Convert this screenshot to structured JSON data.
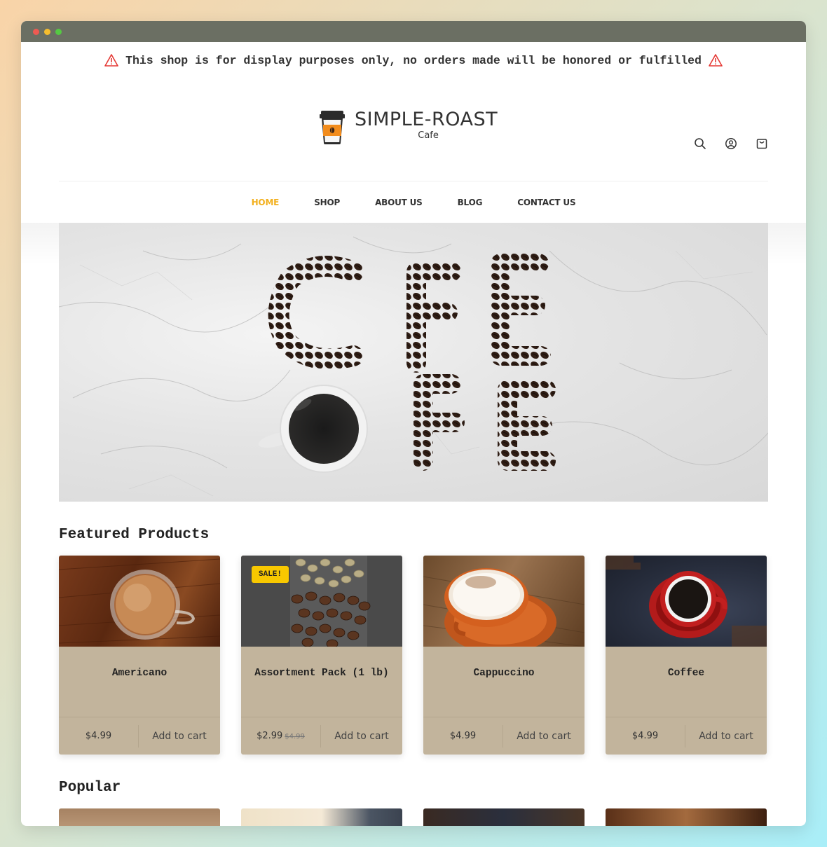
{
  "notice": "This shop is for display purposes only, no orders made will be honored or fulfilled",
  "brand": {
    "title": "SIMPLE-ROAST",
    "subtitle": "Cafe"
  },
  "nav": [
    {
      "label": "HOME",
      "active": true
    },
    {
      "label": "SHOP",
      "active": false
    },
    {
      "label": "ABOUT US",
      "active": false
    },
    {
      "label": "BLOG",
      "active": false
    },
    {
      "label": "CONTACT US",
      "active": false
    }
  ],
  "hero": {
    "letters_top": "CFE",
    "letters_bottom": "FE"
  },
  "featured": {
    "title": "Featured Products",
    "products": [
      {
        "name": "Americano",
        "price": "$4.99",
        "old_price": "",
        "badge": "",
        "add_label": "Add to cart"
      },
      {
        "name": "Assortment Pack (1 lb)",
        "price": "$2.99",
        "old_price": "$4.99",
        "badge": "SALE!",
        "add_label": "Add to cart"
      },
      {
        "name": "Cappuccino",
        "price": "$4.99",
        "old_price": "",
        "badge": "",
        "add_label": "Add to cart"
      },
      {
        "name": "Coffee",
        "price": "$4.99",
        "old_price": "",
        "badge": "",
        "add_label": "Add to cart"
      }
    ]
  },
  "popular": {
    "title": "Popular"
  },
  "colors": {
    "accent": "#f2b01e",
    "card": "#c2b49c",
    "badge": "#f8c800"
  }
}
